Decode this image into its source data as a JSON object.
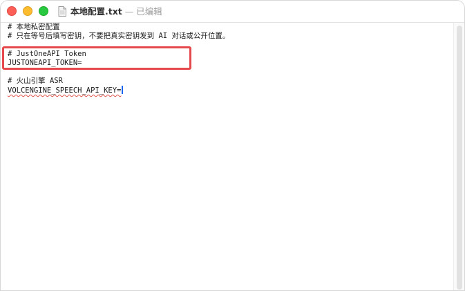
{
  "window": {
    "title": "本地配置.txt",
    "separator": "—",
    "status": "已编辑"
  },
  "editor": {
    "lines": [
      "# 本地私密配置",
      "# 只在等号后填写密钥，不要把真实密钥发到 AI 对话或公开位置。",
      "# JustOneAPI Token",
      "JUSTONEAPI_TOKEN=",
      "# 火山引擎 ASR",
      "VOLCENGINE_SPEECH_API_KEY="
    ]
  },
  "colors": {
    "highlight": "#e5484d",
    "caret": "#1a64f0",
    "close": "#ff5f57",
    "minimize": "#febc2e",
    "maximize": "#28c840"
  },
  "icons": {
    "document": "document-icon"
  }
}
